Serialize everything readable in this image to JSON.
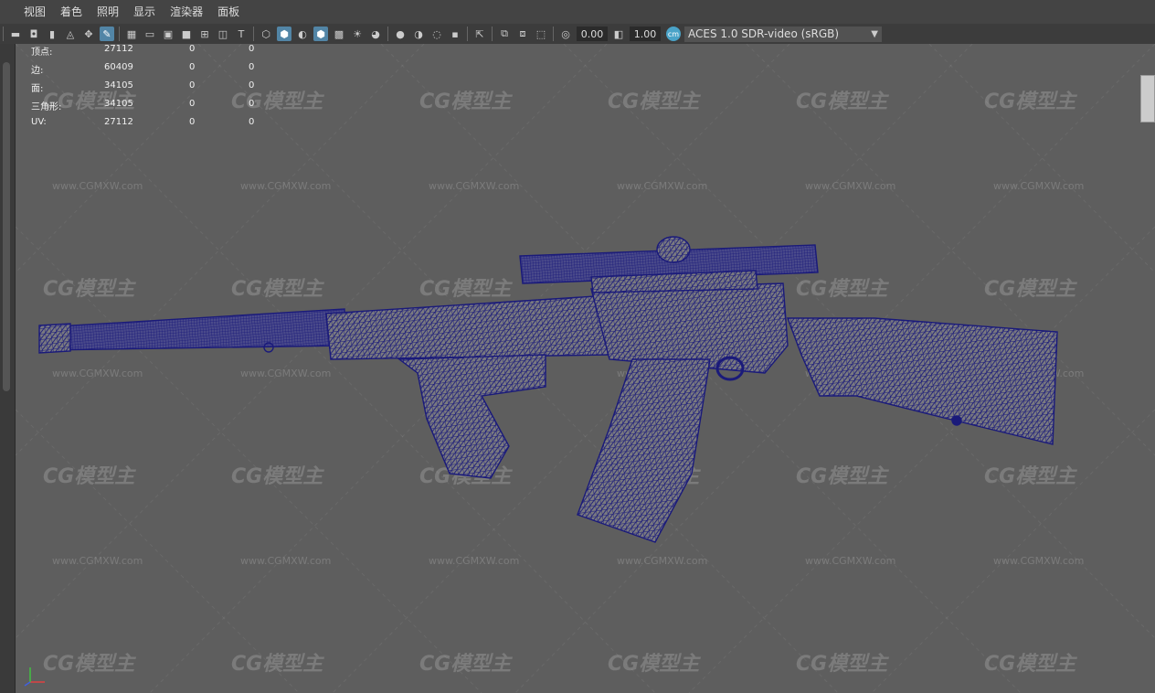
{
  "menubar": {
    "items": [
      "视图",
      "着色",
      "照明",
      "显示",
      "渲染器",
      "面板"
    ]
  },
  "toolbar": {
    "exposure_value": "0.00",
    "gamma_value": "1.00",
    "color_space_badge": "cm",
    "color_space": "ACES 1.0 SDR-video (sRGB)"
  },
  "hud": {
    "rows": [
      {
        "label": "顶点:",
        "a": "27112",
        "b": "0",
        "c": "0"
      },
      {
        "label": "边:",
        "a": "60409",
        "b": "0",
        "c": "0"
      },
      {
        "label": "面:",
        "a": "34105",
        "b": "0",
        "c": "0"
      },
      {
        "label": "三角形:",
        "a": "34105",
        "b": "0",
        "c": "0"
      },
      {
        "label": "UV:",
        "a": "27112",
        "b": "0",
        "c": "0"
      }
    ]
  },
  "watermark": {
    "logo_text": "CG模型主",
    "url": "www.CGMXW.com"
  },
  "colors": {
    "viewport_bg": "#5e5e5e",
    "wireframe": "#1a1a7a",
    "accent": "#5285a6"
  }
}
